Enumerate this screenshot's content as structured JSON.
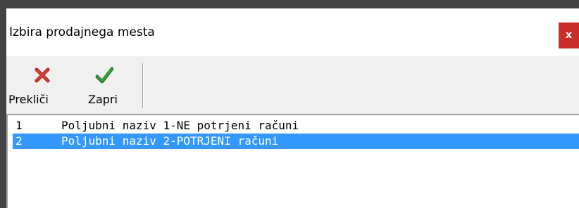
{
  "window": {
    "title": "Izbira prodajnega mesta",
    "close_label": "x"
  },
  "toolbar": {
    "cancel_label": "Prekliči",
    "cancel_icon": "red-x-icon",
    "close_label": "Zapri",
    "close_icon": "green-check-icon"
  },
  "list": {
    "items": [
      {
        "num": "1",
        "name": "Poljubni naziv 1-NE potrjeni računi",
        "selected": false
      },
      {
        "num": "2",
        "name": "Poljubni naziv 2-POTRJENI računi",
        "selected": true
      }
    ]
  },
  "colors": {
    "selection": "#3399ff",
    "close_button": "#c9302c",
    "cancel_icon": "#c0392b",
    "confirm_icon": "#2e8b2e"
  }
}
